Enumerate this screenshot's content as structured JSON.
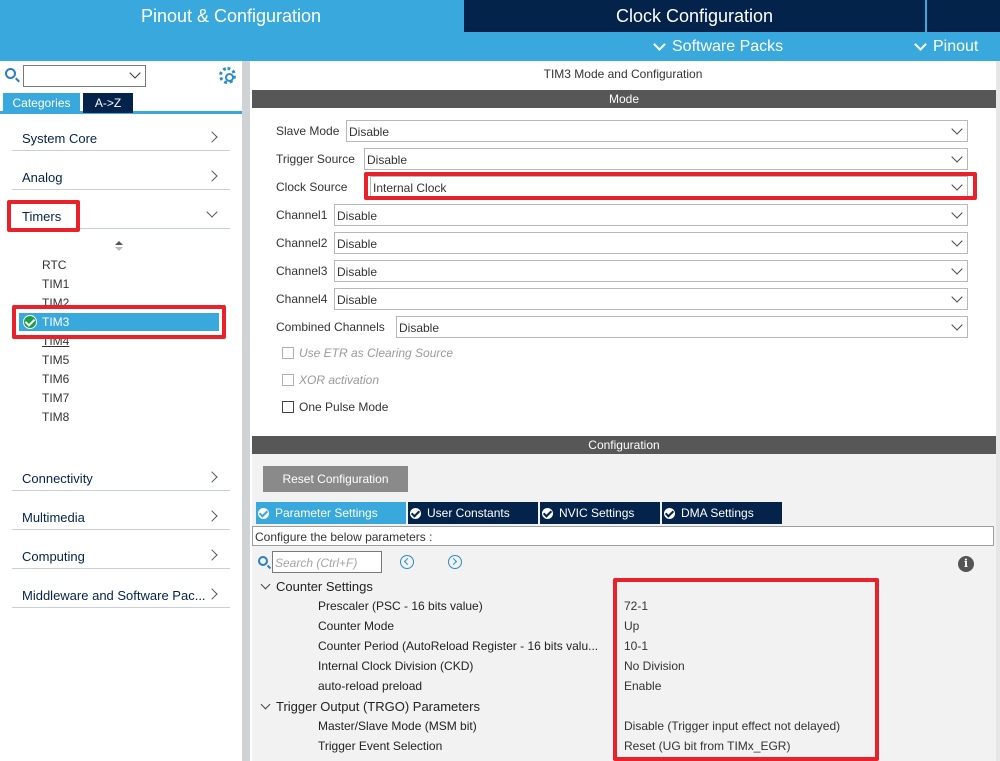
{
  "top_tabs": {
    "pinout_config": "Pinout & Configuration",
    "clock_config": "Clock Configuration"
  },
  "sub_menu": {
    "software_packs": "Software Packs",
    "pinout": "Pinout"
  },
  "left": {
    "search_value": "",
    "tabs": {
      "categories": "Categories",
      "az": "A->Z"
    },
    "categories": [
      {
        "label": "System Core"
      },
      {
        "label": "Analog"
      },
      {
        "label": "Timers"
      },
      {
        "label": "Connectivity"
      },
      {
        "label": "Multimedia"
      },
      {
        "label": "Computing"
      },
      {
        "label": "Middleware and Software Pac..."
      }
    ],
    "timers": [
      "RTC",
      "TIM1",
      "TIM2",
      "TIM3",
      "TIM4",
      "TIM5",
      "TIM6",
      "TIM7",
      "TIM8"
    ],
    "selected_timer": "TIM3"
  },
  "right": {
    "title": "TIM3 Mode and Configuration",
    "mode_header": "Mode",
    "mode_fields": [
      {
        "label": "Slave Mode",
        "value": "Disable"
      },
      {
        "label": "Trigger Source",
        "value": "Disable"
      },
      {
        "label": "Clock Source",
        "value": "Internal Clock"
      },
      {
        "label": "Channel1",
        "value": "Disable"
      },
      {
        "label": "Channel2",
        "value": "Disable"
      },
      {
        "label": "Channel3",
        "value": "Disable"
      },
      {
        "label": "Channel4",
        "value": "Disable"
      },
      {
        "label": "Combined Channels",
        "value": "Disable"
      }
    ],
    "checkboxes": [
      {
        "label": "Use ETR as Clearing Source",
        "enabled": false,
        "checked": false
      },
      {
        "label": "XOR activation",
        "enabled": false,
        "checked": false
      },
      {
        "label": "One Pulse Mode",
        "enabled": true,
        "checked": false
      }
    ],
    "config_header": "Configuration",
    "reset_button": "Reset Configuration",
    "param_tabs": [
      "Parameter Settings",
      "User Constants",
      "NVIC Settings",
      "DMA Settings"
    ],
    "configure_text": "Configure the below parameters :",
    "search_placeholder": "Search (Ctrl+F)",
    "groups": [
      {
        "name": "Counter Settings",
        "params": [
          {
            "name": "Prescaler (PSC - 16 bits value)",
            "value": "72-1"
          },
          {
            "name": "Counter Mode",
            "value": "Up"
          },
          {
            "name": "Counter Period (AutoReload Register - 16 bits valu...",
            "value": "10-1"
          },
          {
            "name": "Internal Clock Division (CKD)",
            "value": "No Division"
          },
          {
            "name": "auto-reload preload",
            "value": "Enable"
          }
        ]
      },
      {
        "name": "Trigger Output (TRGO) Parameters",
        "params": [
          {
            "name": "Master/Slave Mode (MSM bit)",
            "value": "Disable (Trigger input effect not delayed)"
          },
          {
            "name": "Trigger Event Selection",
            "value": "Reset (UG bit from TIMx_EGR)"
          }
        ]
      }
    ]
  },
  "colors": {
    "brand_light": "#39a8dc",
    "brand_dark": "#03234b",
    "highlight": "#e8212b",
    "header_gray": "#575757"
  }
}
